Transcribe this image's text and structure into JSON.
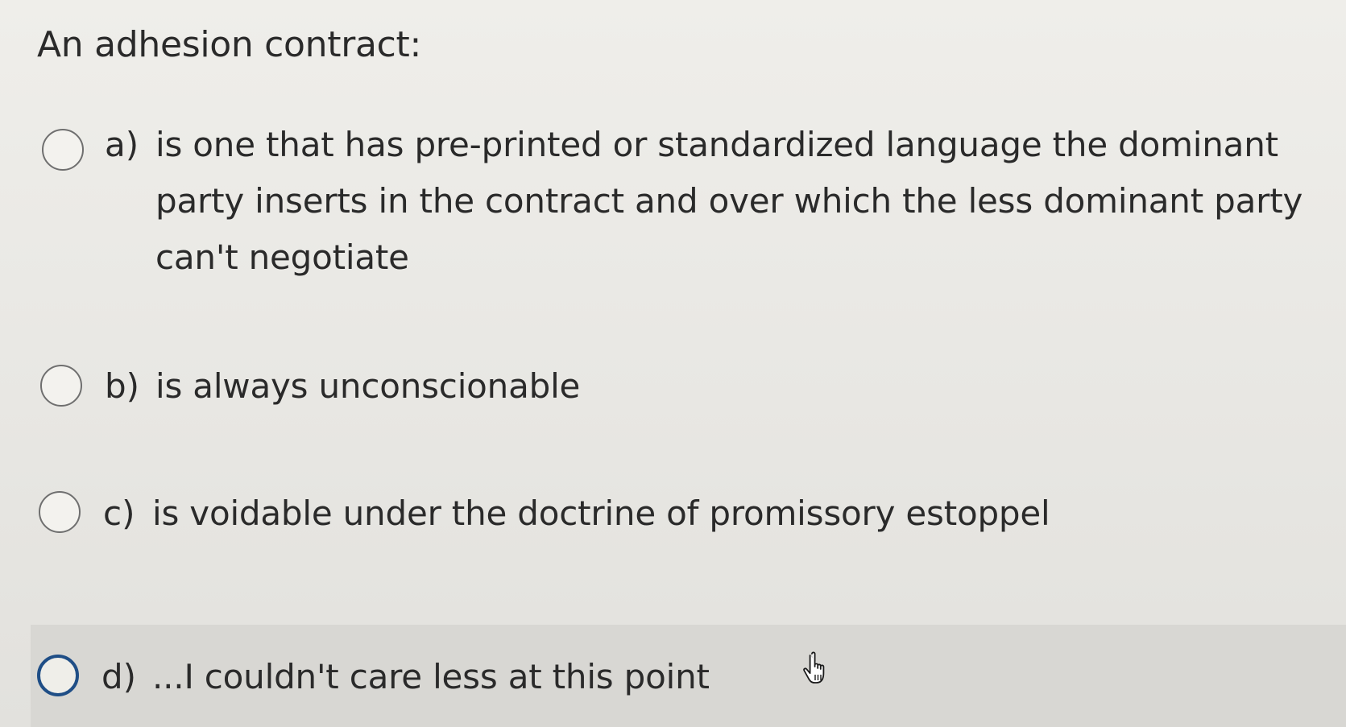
{
  "question": {
    "text": "An adhesion contract:"
  },
  "options": [
    {
      "letter": "a)",
      "text": "is one that has pre-printed or standardized language the dominant party inserts in the contract and over which the less dominant party can't negotiate",
      "selected": false
    },
    {
      "letter": "b)",
      "text": "is always unconscionable",
      "selected": false
    },
    {
      "letter": "c)",
      "text": "is voidable under the doctrine of promissory estoppel",
      "selected": false
    },
    {
      "letter": "d)",
      "text": "...I couldn't care less at this point",
      "selected": false,
      "focused": true
    }
  ],
  "cursor": {
    "icon": "hand-pointer-icon"
  },
  "colors": {
    "focus_ring": "#1f4e86",
    "background": "#e9e8e4",
    "hover_band": "#d8d7d3"
  }
}
